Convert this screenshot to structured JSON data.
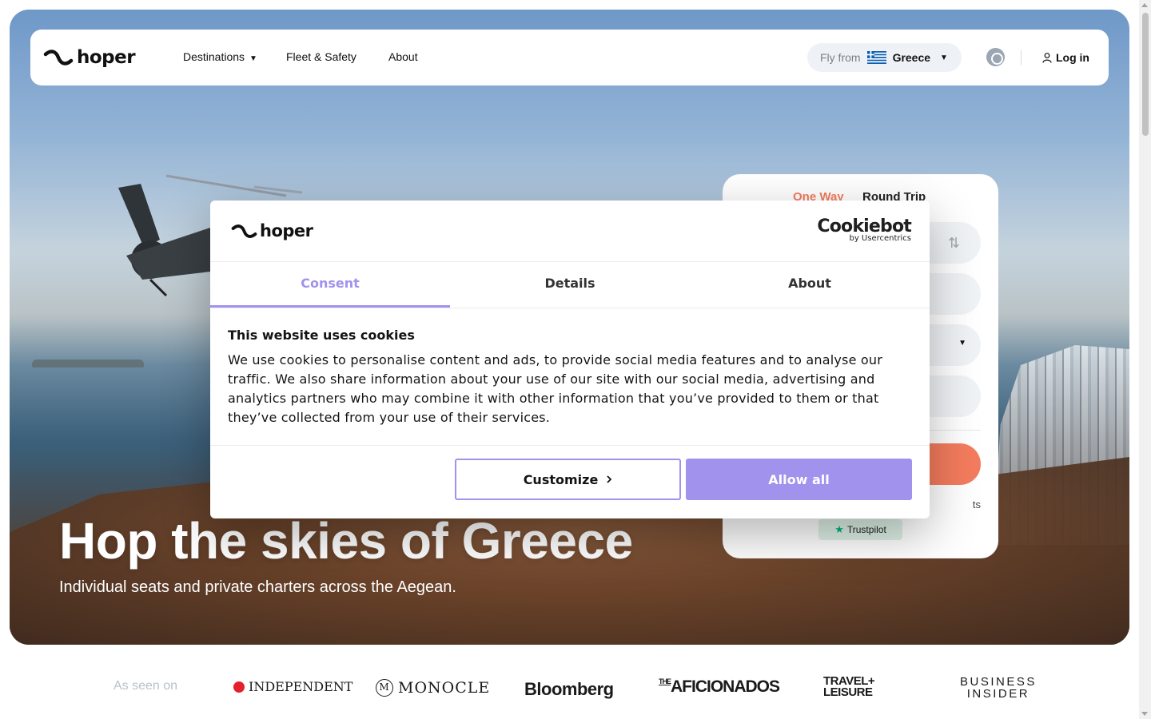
{
  "brand": {
    "name": "hoper"
  },
  "nav": {
    "items": [
      {
        "label": "Destinations"
      },
      {
        "label": "Fleet & Safety"
      },
      {
        "label": "About"
      }
    ],
    "fly_from": {
      "label": "Fly from",
      "value": "Greece"
    },
    "login": "Log in"
  },
  "booking": {
    "tabs": [
      "One Way",
      "Round Trip"
    ],
    "note_partial": "ts",
    "trustpilot": "Trustpilot"
  },
  "hero": {
    "title": "Hop the skies of Greece",
    "subtitle": "Individual seats and private charters across the Aegean."
  },
  "cookie_modal": {
    "provider_name": "Cookiebot",
    "provider_by": "by Usercentrics",
    "tabs": [
      "Consent",
      "Details",
      "About"
    ],
    "active_tab": "Consent",
    "heading": "This website uses cookies",
    "body": "We use cookies to personalise content and ads, to provide social media features and to analyse our traffic. We also share information about your use of our site with our social media, advertising and analytics partners who may combine it with other information that you’ve provided to them or that they’ve collected from your use of their services.",
    "customize": "Customize",
    "allow_all": "Allow all",
    "accent_color": "#a192ee"
  },
  "press": {
    "label": "As seen on",
    "logos": {
      "independent": "INDEPENDENT",
      "monocle": "MONOCLE",
      "bloomberg": "Bloomberg",
      "aficionados_the": "THE",
      "aficionados": "AFICIONADOS",
      "travel_1": "TRAVEL+",
      "travel_2": "LEISURE",
      "bi_1": "BUSINESS",
      "bi_2": "INSIDER"
    }
  },
  "colors": {
    "accent": "#f47c5e",
    "modal_accent": "#a192ee"
  }
}
